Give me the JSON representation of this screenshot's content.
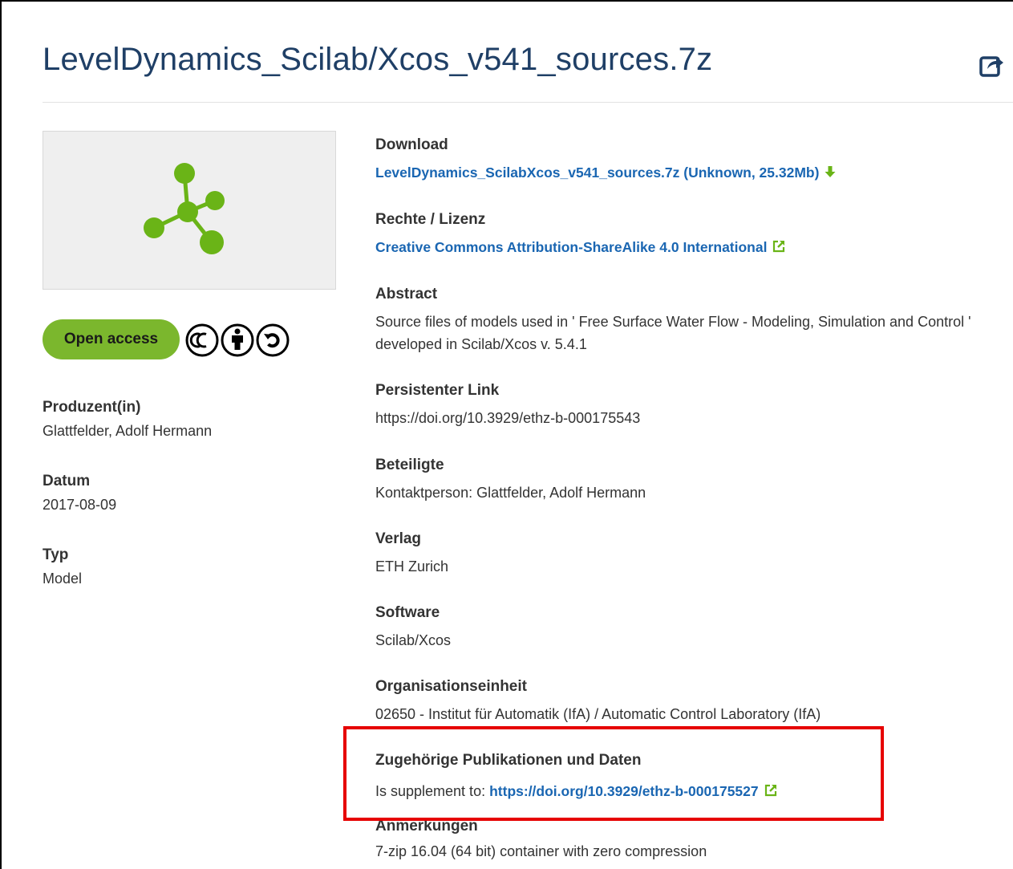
{
  "title": "LevelDynamics_Scilab/Xcos_v541_sources.7z",
  "badge": {
    "open_access": "Open access"
  },
  "side": [
    {
      "label": "Produzent(in)",
      "value": "Glattfelder, Adolf Hermann"
    },
    {
      "label": "Datum",
      "value": "2017-08-09"
    },
    {
      "label": "Typ",
      "value": "Model"
    }
  ],
  "download": {
    "label": "Download",
    "link": "LevelDynamics_ScilabXcos_v541_sources.7z (Unknown, 25.32Mb)"
  },
  "license": {
    "label": "Rechte / Lizenz",
    "link": "Creative Commons Attribution-ShareAlike 4.0 International"
  },
  "abstract": {
    "label": "Abstract",
    "text": "Source files of models used in ' Free Surface Water Flow - Modeling, Simulation and Control ' developed in Scilab/Xcos v. 5.4.1"
  },
  "persistent": {
    "label": "Persistenter Link",
    "value": "https://doi.org/10.3929/ethz-b-000175543"
  },
  "contributors": {
    "label": "Beteiligte",
    "value": "Kontaktperson: Glattfelder, Adolf Hermann"
  },
  "publisher": {
    "label": "Verlag",
    "value": "ETH Zurich"
  },
  "software": {
    "label": "Software",
    "value": "Scilab/Xcos"
  },
  "org": {
    "label": "Organisationseinheit",
    "value": "02650 - Institut für Automatik (IfA) / Automatic Control Laboratory (IfA)"
  },
  "related": {
    "label": "Zugehörige Publikationen und Daten",
    "prefix": "Is supplement to:",
    "link": "https://doi.org/10.3929/ethz-b-000175527"
  },
  "notes": {
    "label": "Anmerkungen",
    "value": "7-zip 16.04 (64 bit) container with zero compression"
  },
  "colors": {
    "title": "#1f3f66",
    "link": "#1a66b2",
    "accent_green": "#7bb72d",
    "highlight": "#e60000"
  },
  "icons": {
    "share": "share-icon",
    "download": "download-arrow-icon",
    "external": "external-link-icon",
    "thumb": "dataset-molecule-icon",
    "license": "cc-by-sa-icon"
  }
}
